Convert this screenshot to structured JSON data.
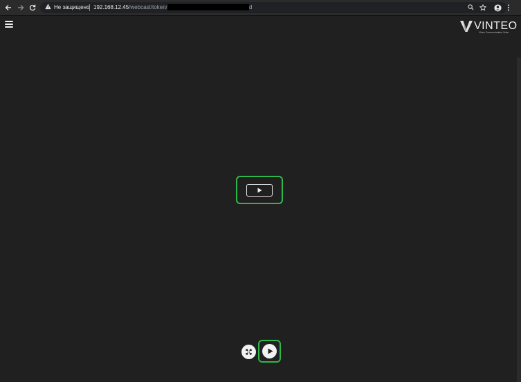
{
  "browser": {
    "back_icon": "arrow-left-icon",
    "forward_icon": "arrow-right-icon",
    "reload_icon": "reload-icon",
    "security_label": "Не защищено",
    "url_host": "192.168.12.45",
    "url_path": "/webcast/token/ed",
    "url_tail": "d",
    "zoom_icon": "search-icon",
    "bookmark_icon": "star-icon",
    "profile_icon": "account-icon",
    "menu_icon": "more-vertical-icon"
  },
  "app": {
    "menu_icon": "hamburger-icon",
    "logo_text": "VINTEO",
    "logo_tagline": "Video Communication Suite"
  },
  "player": {
    "center_play_icon": "play-icon",
    "fullscreen_icon": "expand-icon",
    "play_icon": "play-icon",
    "highlight_color": "#2db84b"
  }
}
